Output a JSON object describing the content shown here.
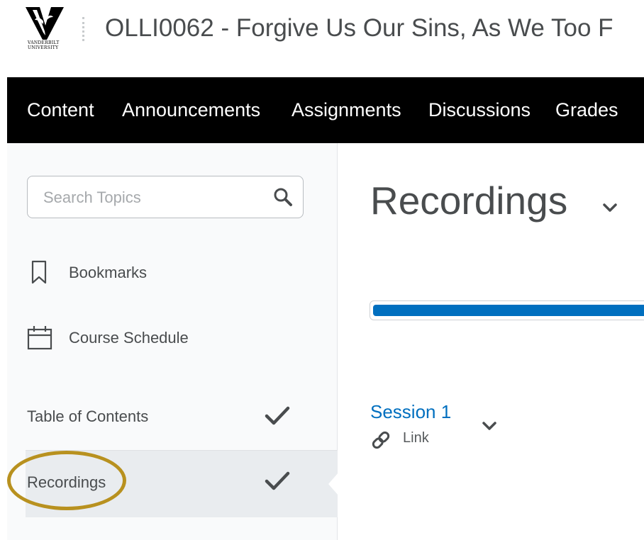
{
  "header": {
    "logo_text_line1": "VANDERBILT",
    "logo_text_line2": "UNIVERSITY",
    "course_title": "OLLI0062 - Forgive Us Our Sins, As We Too F"
  },
  "nav": {
    "items": [
      {
        "label": "Content"
      },
      {
        "label": "Announcements"
      },
      {
        "label": "Assignments"
      },
      {
        "label": "Discussions"
      },
      {
        "label": "Grades"
      }
    ]
  },
  "sidebar": {
    "search_placeholder": "Search Topics",
    "search_icon": "search-icon",
    "bookmarks_label": "Bookmarks",
    "bookmarks_icon": "bookmark-icon",
    "schedule_label": "Course Schedule",
    "schedule_icon": "calendar-icon",
    "modules": [
      {
        "label": "Table of Contents",
        "completed": true,
        "selected": false
      },
      {
        "label": "Recordings",
        "completed": true,
        "selected": true
      }
    ],
    "highlight_color": "#b8911f"
  },
  "main": {
    "module_title": "Recordings",
    "progress": 1.0,
    "progress_color": "#006fbf",
    "topics": [
      {
        "title": "Session 1",
        "type": "Link",
        "type_icon": "link-icon"
      }
    ]
  }
}
